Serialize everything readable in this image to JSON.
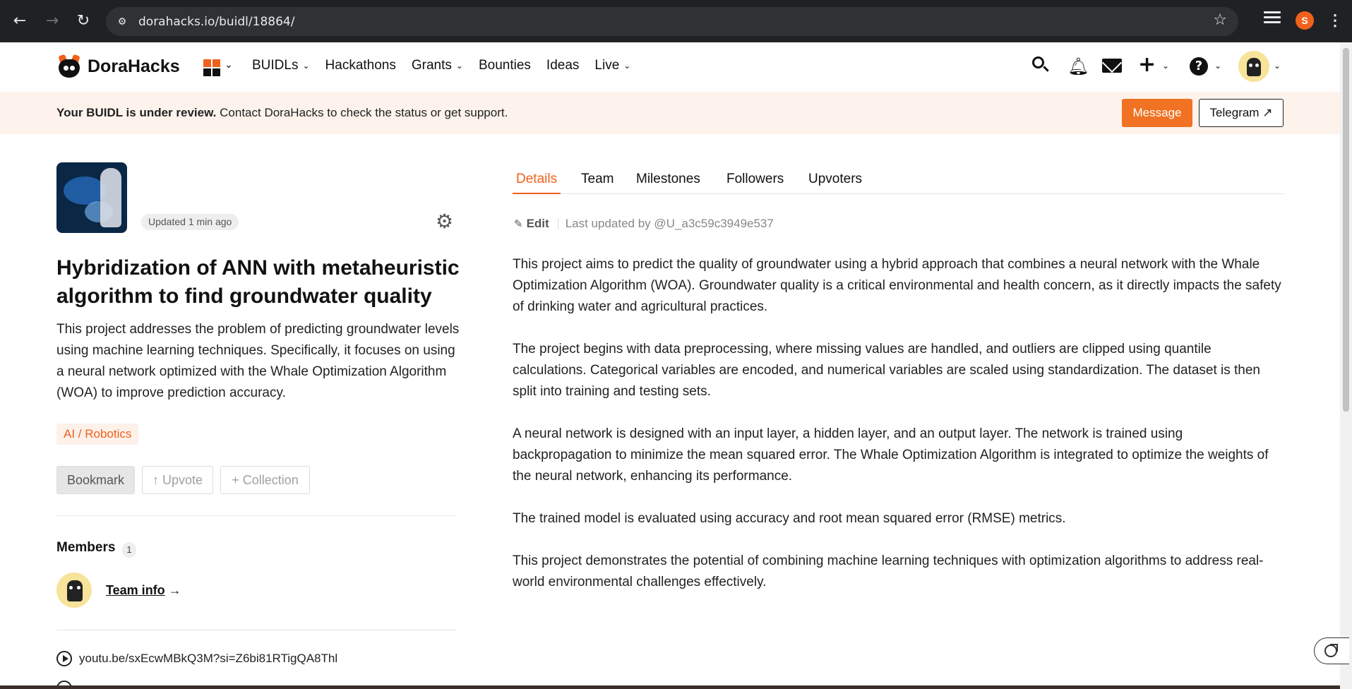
{
  "browser": {
    "url": "dorahacks.io/buidl/18864/",
    "profile_initial": "S"
  },
  "header": {
    "brand": "DoraHacks",
    "nav": [
      "BUIDLs",
      "Hackathons",
      "Grants",
      "Bounties",
      "Ideas",
      "Live"
    ]
  },
  "notice": {
    "bold": "Your BUIDL is under review.",
    "text": " Contact DoraHacks to check the status or get support.",
    "message_label": "Message",
    "telegram_label": "Telegram ↗"
  },
  "project": {
    "updated": "Updated 1 min ago",
    "title": "Hybridization of ANN with metaheuristic algorithm to find groundwater quality",
    "description": "This project addresses the problem of predicting groundwater levels using machine learning techniques. Specifically, it focuses on using a neural network optimized with the Whale Optimization Algorithm (WOA) to improve prediction accuracy.",
    "tag": "AI / Robotics",
    "bookmark_label": "Bookmark",
    "upvote_label": "↑ Upvote",
    "collection_label": "+ Collection",
    "members_label": "Members",
    "members_count": "1",
    "team_link": "Team info",
    "team_arrow": " →",
    "video_link": "youtu.be/sxEcwMBkQ3M?si=Z6bi81RTigQA8Thl"
  },
  "tabs": [
    "Details",
    "Team",
    "Milestones",
    "Followers",
    "Upvoters"
  ],
  "details": {
    "edit_label": "Edit",
    "last_updated": "Last updated by @U_a3c59c3949e537",
    "paragraphs": [
      "This project aims to predict the quality of groundwater using a hybrid approach that combines a neural network with the Whale Optimization Algorithm (WOA). Groundwater quality is a critical environmental and health concern, as it directly impacts the safety of drinking water and agricultural practices.",
      "The project begins with data preprocessing, where missing values are handled, and outliers are clipped using quantile calculations. Categorical variables are encoded, and numerical variables are scaled using standardization. The dataset is then split into training and testing sets.",
      "A neural network is designed with an input layer, a hidden layer, and an output layer. The network is trained using backpropagation to minimize the mean squared error. The Whale Optimization Algorithm is integrated to optimize the weights of the neural network, enhancing its performance.",
      "The trained model is evaluated using accuracy and root mean squared error (RMSE) metrics.",
      "This project demonstrates the potential of combining machine learning techniques with optimization algorithms to address real-world environmental challenges effectively."
    ]
  },
  "colors": {
    "accent": "#f0611c",
    "banner_bg": "#fdf3ec",
    "browser_bg": "#202124"
  }
}
